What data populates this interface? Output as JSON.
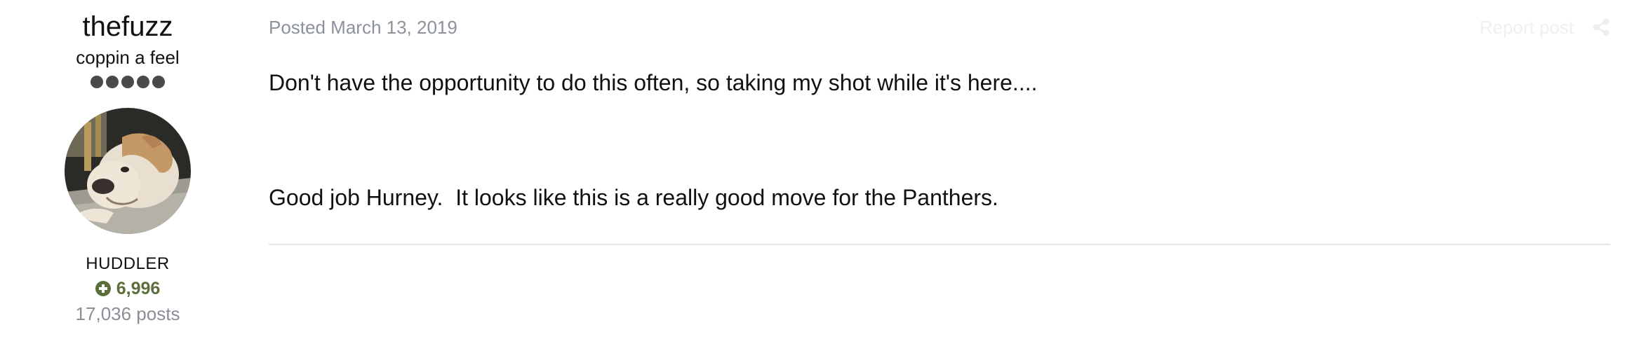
{
  "author": {
    "username": "thefuzz",
    "title": "coppin a feel",
    "rank_pips": 5,
    "avatar_icon": "bulldog-avatar",
    "group": "HUDDLER",
    "reputation": "6,996",
    "posts": "17,036 posts"
  },
  "post": {
    "date": "Posted March 13, 2019",
    "report_label": "Report post",
    "share_icon": "share-icon",
    "paragraphs": [
      "Don't have the opportunity to do this often, so taking my shot while it's here....",
      "Good job Hurney.  It looks like this is a really good move for the Panthers."
    ]
  },
  "colors": {
    "reputation_green": "#5a6f3a",
    "meta_gray": "#8c929a",
    "pip_gray": "#4a4a4a"
  }
}
